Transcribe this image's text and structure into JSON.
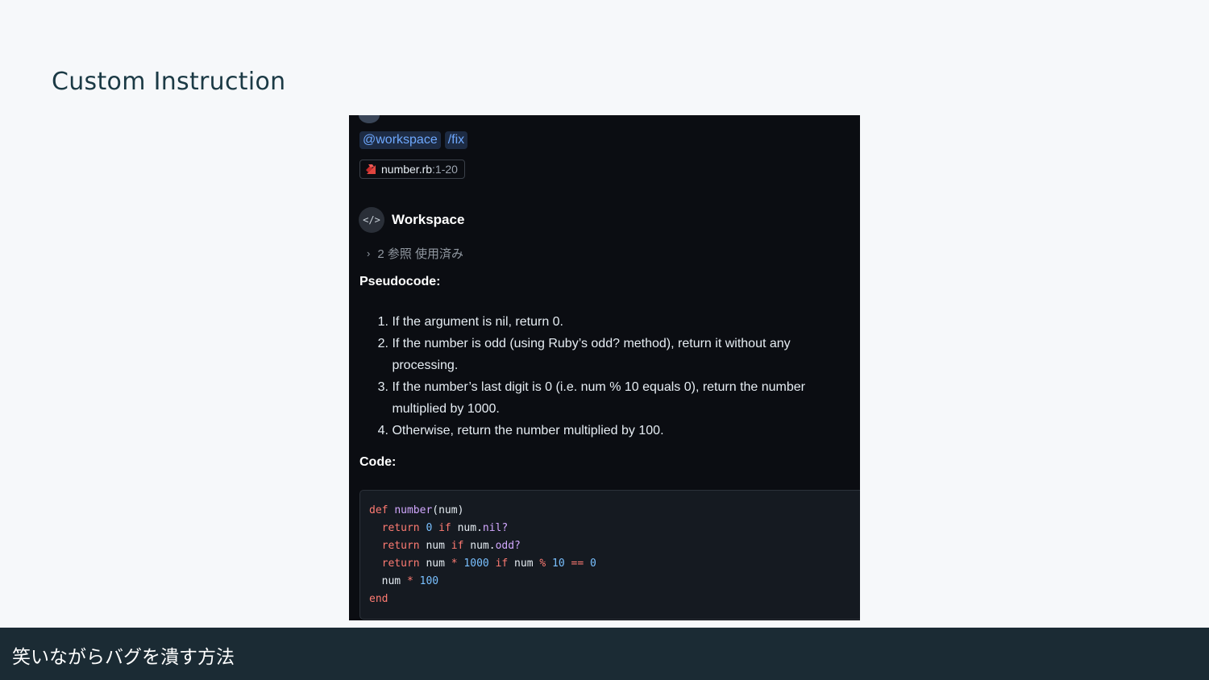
{
  "slide": {
    "title": "Custom Instruction",
    "footer": "笑いながらバグを潰す方法"
  },
  "chat": {
    "chips": [
      "@workspace",
      "/fix"
    ],
    "file_ref": {
      "name": "number.rb",
      "range": ":1-20",
      "icon": "ruby-icon"
    },
    "agent": {
      "name": "Workspace",
      "icon": "code-icon"
    },
    "references": "2 参照 使用済み",
    "pseudocode_heading": "Pseudocode:",
    "steps": [
      {
        "num": "1.",
        "lines": [
          "If the argument is nil, return 0."
        ]
      },
      {
        "num": "2.",
        "lines": [
          "If the number is odd (using Ruby’s odd? method), return it without any",
          "processing."
        ]
      },
      {
        "num": "3.",
        "lines": [
          "If the number’s last digit is 0 (i.e. num % 10 equals 0), return the number",
          "multiplied by 1000."
        ]
      },
      {
        "num": "4.",
        "lines": [
          "Otherwise, return the number multiplied by 100."
        ]
      }
    ],
    "code_heading": "Code:",
    "code_lines": [
      "def number(num)",
      "  return 0 if num.nil?",
      "  return num if num.odd?",
      "  return num * 1000 if num % 10 == 0",
      "  num * 100",
      "end"
    ]
  },
  "colors": {
    "slide_bg": "#f6f8fa",
    "footer_bg": "#1b2b34",
    "panel_bg": "#0b0d12",
    "chip_fg": "#6ea8fe",
    "keyword": "#ff7b72",
    "function": "#d2a8ff",
    "number": "#79c0ff"
  }
}
